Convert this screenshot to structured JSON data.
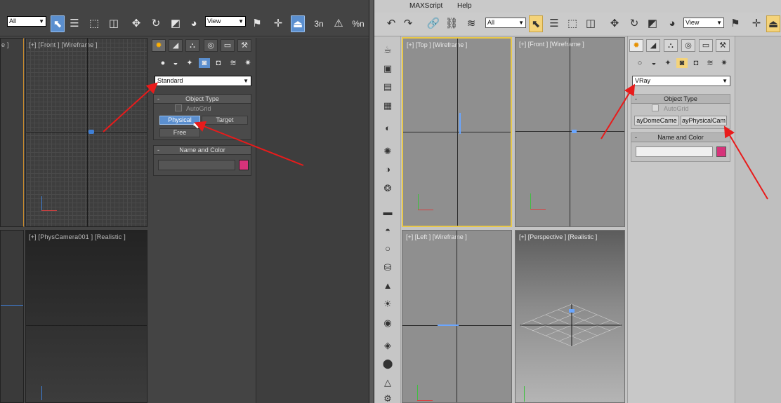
{
  "left_window": {
    "toolbar": {
      "selection_filter": "All",
      "ref_coord": "View",
      "snap_label": "3"
    },
    "viewports": {
      "front_label": "[+] [Front ] [Wireframe ]",
      "camera_label": "[+] [PhysCamera001 ] [Realistic ]",
      "stub_label": "e ]"
    },
    "command_panel": {
      "category_dropdown": "Standard",
      "object_type": {
        "title": "Object Type",
        "autogrid": "AutoGrid",
        "buttons": [
          "Physical",
          "Target",
          "Free"
        ]
      },
      "name_and_color": {
        "title": "Name and Color",
        "swatch_color": "#d6337a"
      }
    }
  },
  "right_window": {
    "menubar": [
      "MAXScript",
      "Help"
    ],
    "toolbar": {
      "selection_filter": "All",
      "ref_coord": "View"
    },
    "viewports": {
      "top_label": "[+] [Top ] [Wireframe ]",
      "front_label": "[+] [Front ] [Wireframe ]",
      "left_label": "[+] [Left ] [Wireframe ]",
      "persp_label": "[+] [Perspective ] [Realistic ]"
    },
    "command_panel": {
      "category_dropdown": "VRay",
      "object_type": {
        "title": "Object Type",
        "autogrid": "AutoGrid",
        "buttons": [
          "ayDomeCame",
          "ayPhysicalCam"
        ]
      },
      "name_and_color": {
        "title": "Name and Color",
        "swatch_color": "#d6337a"
      }
    }
  },
  "colors": {
    "annotation_arrow": "#e81b1b",
    "active_blue": "#5b8fcf",
    "active_yellow": "#f4d37a"
  }
}
